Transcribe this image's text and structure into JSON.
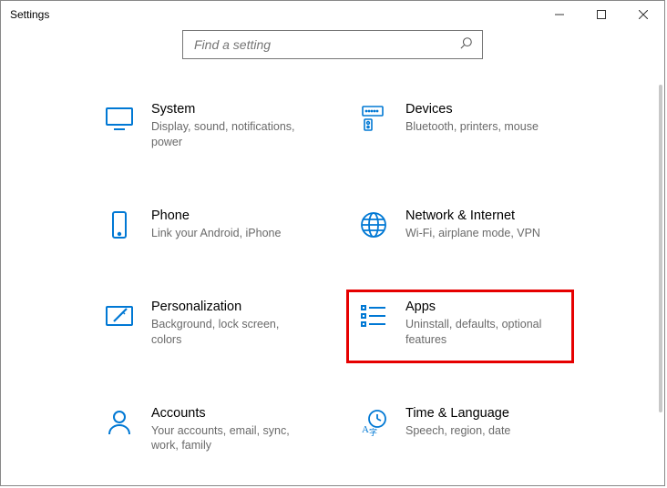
{
  "window": {
    "title": "Settings"
  },
  "search": {
    "placeholder": "Find a setting"
  },
  "tiles": {
    "system": {
      "title": "System",
      "desc": "Display, sound, notifications, power"
    },
    "devices": {
      "title": "Devices",
      "desc": "Bluetooth, printers, mouse"
    },
    "phone": {
      "title": "Phone",
      "desc": "Link your Android, iPhone"
    },
    "network": {
      "title": "Network & Internet",
      "desc": "Wi-Fi, airplane mode, VPN"
    },
    "personal": {
      "title": "Personalization",
      "desc": "Background, lock screen, colors"
    },
    "apps": {
      "title": "Apps",
      "desc": "Uninstall, defaults, optional features"
    },
    "accounts": {
      "title": "Accounts",
      "desc": "Your accounts, email, sync, work, family"
    },
    "time": {
      "title": "Time & Language",
      "desc": "Speech, region, date"
    }
  }
}
